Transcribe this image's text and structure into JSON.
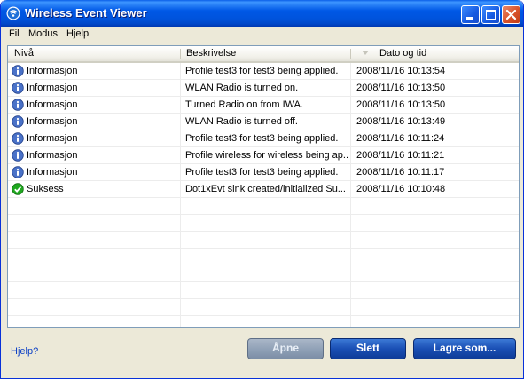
{
  "window": {
    "title": "Wireless Event Viewer",
    "controls": [
      "minimize",
      "maximize",
      "close"
    ]
  },
  "menu": [
    "Fil",
    "Modus",
    "Hjelp"
  ],
  "table": {
    "columns": [
      "Nivå",
      "Beskrivelse",
      "Dato og tid"
    ],
    "sorted_column": "Dato og tid",
    "rows": [
      {
        "level": "Informasjon",
        "icon": "info-icon",
        "description": "Profile test3 for test3 being applied.",
        "datetime": "2008/11/16 10:13:54"
      },
      {
        "level": "Informasjon",
        "icon": "info-icon",
        "description": "WLAN Radio is turned on.",
        "datetime": "2008/11/16 10:13:50"
      },
      {
        "level": "Informasjon",
        "icon": "info-icon",
        "description": "Turned Radio on from IWA.",
        "datetime": "2008/11/16 10:13:50"
      },
      {
        "level": "Informasjon",
        "icon": "info-icon",
        "description": "WLAN Radio is turned off.",
        "datetime": "2008/11/16 10:13:49"
      },
      {
        "level": "Informasjon",
        "icon": "info-icon",
        "description": "Profile test3 for test3 being applied.",
        "datetime": "2008/11/16 10:11:24"
      },
      {
        "level": "Informasjon",
        "icon": "info-icon",
        "description": "Profile wireless for wireless being ap...",
        "datetime": "2008/11/16 10:11:21"
      },
      {
        "level": "Informasjon",
        "icon": "info-icon",
        "description": "Profile test3 for test3 being applied.",
        "datetime": "2008/11/16 10:11:17"
      },
      {
        "level": "Suksess",
        "icon": "success-check-icon",
        "description": "Dot1xEvt sink created/initialized Su...",
        "datetime": "2008/11/16 10:10:48"
      }
    ]
  },
  "footer": {
    "help_link": "Hjelp?",
    "buttons": {
      "open": {
        "label": "Åpne",
        "enabled": false
      },
      "delete": {
        "label": "Slett",
        "enabled": true
      },
      "save_as": {
        "label": "Lagre som...",
        "enabled": true
      }
    }
  },
  "colors": {
    "titlebar": "#0058e6",
    "button_blue": "#1a4fb4",
    "button_disabled": "#8fa0b6",
    "link": "#0b3fc5",
    "success": "#1fa81f"
  }
}
